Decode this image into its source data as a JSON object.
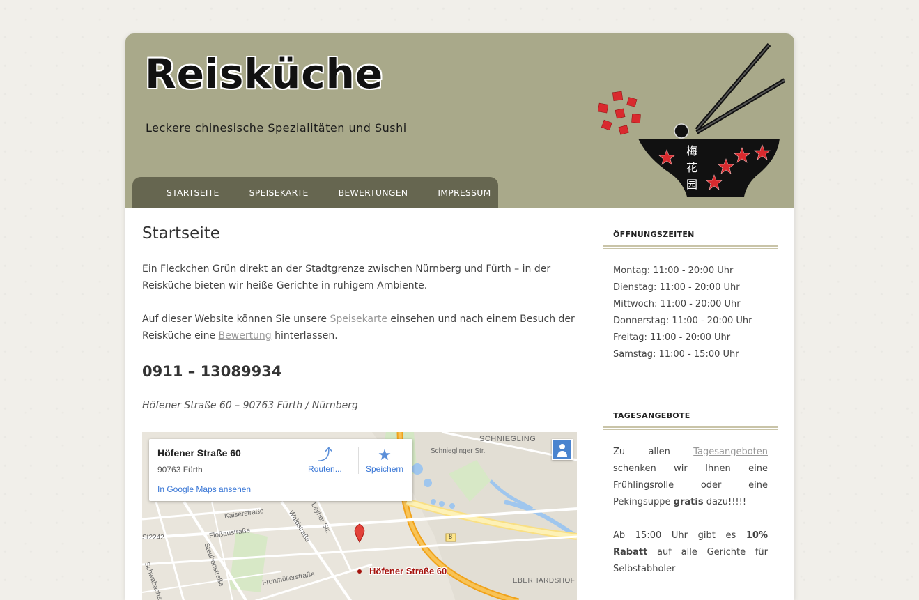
{
  "header": {
    "title": "Reisküche",
    "tagline": "Leckere chinesische Spezialitäten und Sushi",
    "logo_chars": [
      "梅",
      "花",
      "园"
    ]
  },
  "nav": {
    "items": [
      "STARTSEITE",
      "SPEISEKARTE",
      "BEWERTUNGEN",
      "IMPRESSUM"
    ]
  },
  "main": {
    "title": "Startseite",
    "intro": "Ein Fleckchen Grün direkt an der Stadtgrenze zwischen Nürnberg und Fürth – in der Reisküche bieten wir heiße Gerichte in ruhigem Ambiente.",
    "website_text_1": "Auf dieser Website können Sie unsere ",
    "speisekarte_link": "Speisekarte",
    "website_text_2": " einsehen und nach einem Besuch der Reis­küche eine ",
    "bewertung_link": "Bewertung",
    "website_text_3": " hinterlassen.",
    "phone": "0911 – 13089934",
    "address": "Höfener Straße 60 – 90763 Fürth / Nürnberg"
  },
  "map": {
    "card_title": "Höfener Straße 60",
    "card_subtitle": "90763 Fürth",
    "card_link": "In Google Maps ansehen",
    "directions_label": "Routen...",
    "save_label": "Speichern",
    "pin_label": "Höfener Straße 60",
    "labels": {
      "schniegling": "SCHNIEGLING",
      "schnieglinger": "Schnieglinger Str.",
      "kaiser": "Kaiserstraße",
      "floss": "Floßaustraße",
      "wald": "Waldstraße",
      "leyher": "Leyher Str.",
      "st2242": "St2242",
      "schwabacher": "Schwabacher",
      "steuben": "Steubenstraße",
      "fronmueller": "Fronmüllerstraße",
      "eberhardshof": "EBERHARDSHOF",
      "b8": "8"
    }
  },
  "sidebar": {
    "hours_title": "ÖFFNUNGSZEITEN",
    "hours": [
      "Montag: 11:00 - 20:00 Uhr",
      "Dienstag: 11:00 - 20:00 Uhr",
      "Mittwoch: 11:00 - 20:00 Uhr",
      "Donnerstag: 11:00 - 20:00 Uhr",
      "Freitag: 11:00 - 20:00 Uhr",
      "Samstag: 11:00 - 15:00 Uhr"
    ],
    "offers_title": "TAGESANGEBOTE",
    "offer1_a": "Zu allen ",
    "offer1_link": "Tagesangeboten",
    "offer1_b": " schenken wir Ihnen eine Frühlingsrolle oder eine Pekingsuppe ",
    "offer1_bold": "gratis",
    "offer1_c": " dazu!!!!!",
    "offer2_a": "Ab 15:00 Uhr gibt es ",
    "offer2_bold": "10% Rabatt",
    "offer2_b": " auf alle Gerichte für Selbstabholer"
  },
  "colors": {
    "header_bg": "#a9a98a",
    "nav_bg": "#666650",
    "rule": "#c9c4a8",
    "pin": "#e2423a"
  }
}
